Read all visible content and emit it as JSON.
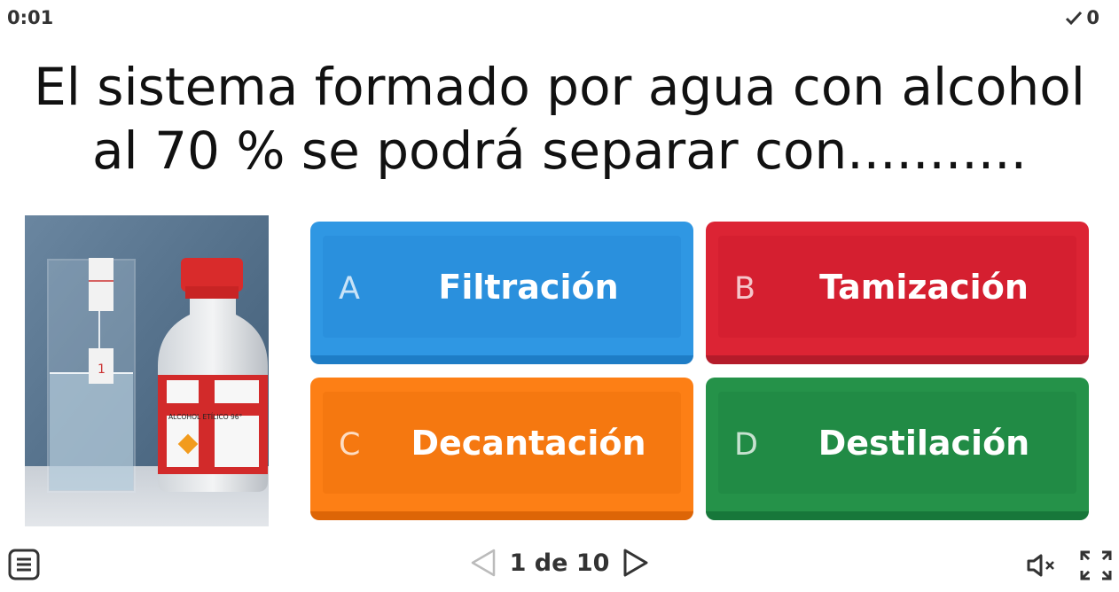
{
  "timer": "0:01",
  "score": {
    "value": "0",
    "icon": "check-icon"
  },
  "question": {
    "line1": "El sistema formado por agua con alcohol",
    "line2": "al 70 % se podrá separar con..........."
  },
  "answers": [
    {
      "letter": "A",
      "label": "Filtración",
      "color": "#2f97e3"
    },
    {
      "letter": "B",
      "label": "Tamización",
      "color": "#dc2434"
    },
    {
      "letter": "C",
      "label": "Decantación",
      "color": "#fd7f15"
    },
    {
      "letter": "D",
      "label": "Destilación",
      "color": "#259249"
    }
  ],
  "photo": {
    "bottle_label": "ALCOHOL ETÍLICO 96°",
    "glass_mark": "1"
  },
  "pager": {
    "text": "1 de 10"
  },
  "icons": {
    "menu": "menu-icon",
    "prev": "prev-arrow-icon",
    "next": "next-arrow-icon",
    "mute": "muted-speaker-icon",
    "fullscreen": "fullscreen-icon"
  }
}
